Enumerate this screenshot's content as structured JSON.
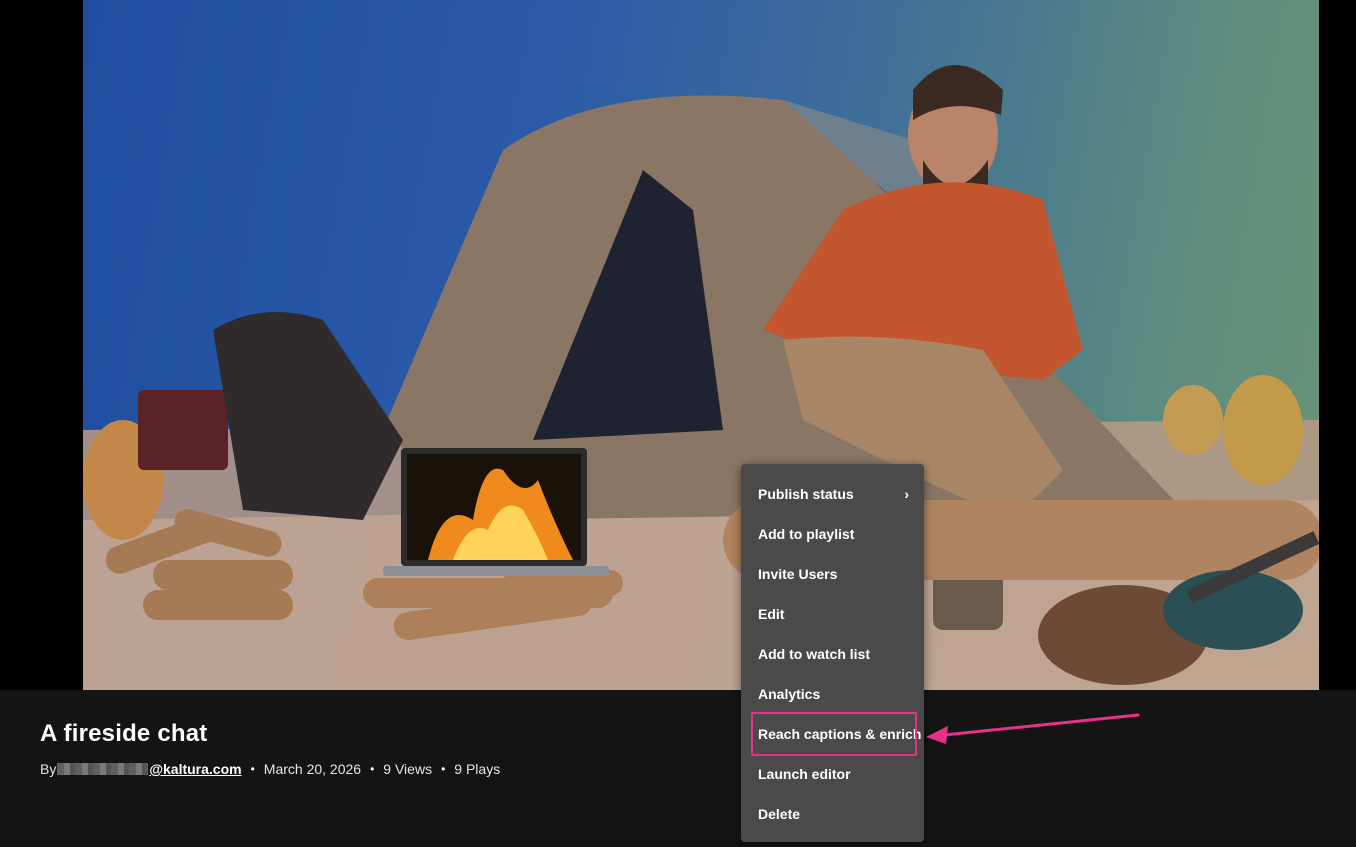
{
  "entry": {
    "title": "A fireside chat",
    "by_label": "By",
    "author_domain": "@kaltura.com",
    "date": "March 20, 2026",
    "views": "9 Views",
    "plays": "9 Plays",
    "separator": "•"
  },
  "menu": {
    "items": [
      {
        "label": "Publish status",
        "has_submenu": true,
        "chevron": "›"
      },
      {
        "label": "Add to playlist"
      },
      {
        "label": "Invite Users"
      },
      {
        "label": "Edit"
      },
      {
        "label": "Add to watch list"
      },
      {
        "label": "Analytics"
      },
      {
        "label": "Reach captions & enrich",
        "highlighted": true
      },
      {
        "label": "Launch editor"
      },
      {
        "label": "Delete"
      }
    ]
  },
  "colors": {
    "page_bg": "#141414",
    "menu_bg": "#4a4a4a",
    "annotation": "#e8308a"
  }
}
